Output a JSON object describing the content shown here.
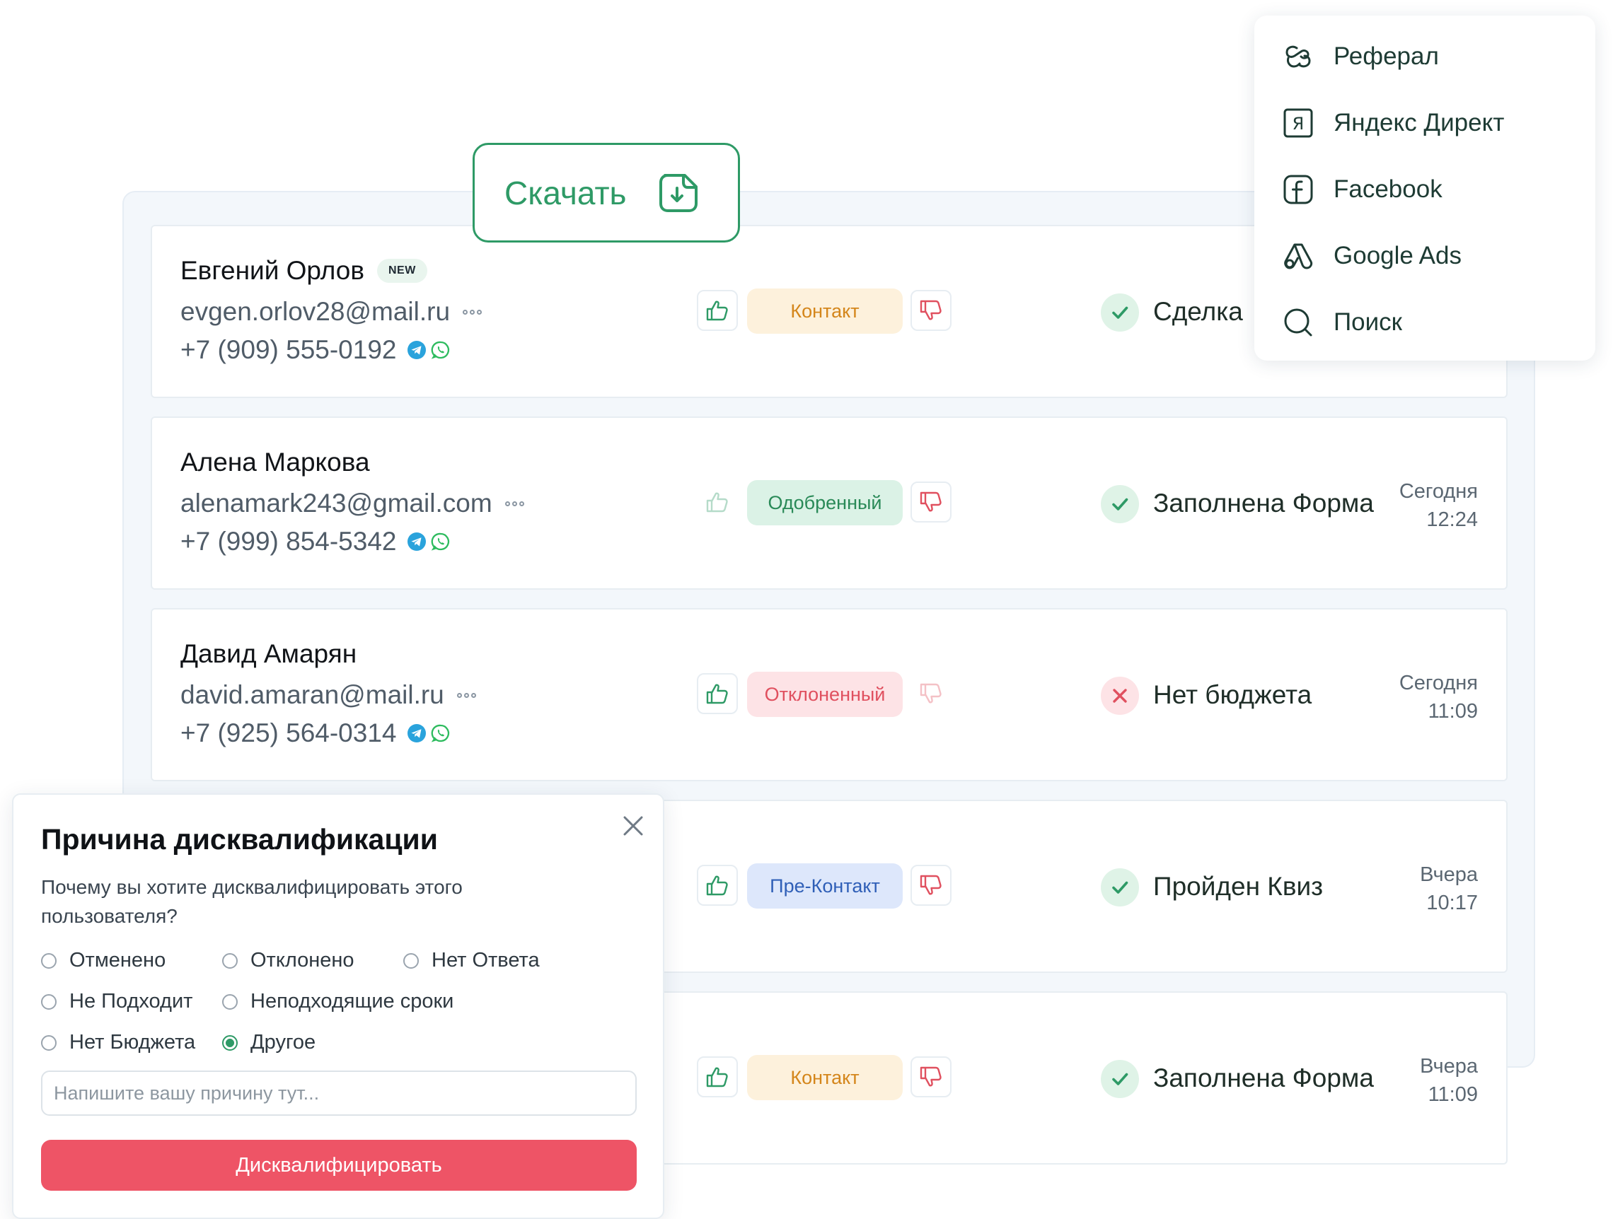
{
  "download": {
    "label": "Скачать"
  },
  "sources": [
    {
      "label": "Реферал",
      "icon": "referral-icon"
    },
    {
      "label": "Яндекс Директ",
      "icon": "yandex-icon"
    },
    {
      "label": "Facebook",
      "icon": "facebook-icon"
    },
    {
      "label": "Google Ads",
      "icon": "google-ads-icon"
    },
    {
      "label": "Поиск",
      "icon": "search-icon"
    }
  ],
  "leads": [
    {
      "name": "Евгений Орлов",
      "badge": "NEW",
      "email": "evgen.orlov28@mail.ru",
      "phone": "+7 (909) 555-0192",
      "status": "Контакт",
      "stage": "Сделка",
      "stage_ok": true,
      "date_day": "",
      "date_time": ""
    },
    {
      "name": "Алена Маркова",
      "badge": "",
      "email": "alenamark243@gmail.com",
      "phone": "+7 (999) 854-5342",
      "status": "Одобренный",
      "stage": "Заполнена Форма",
      "stage_ok": true,
      "date_day": "Сегодня",
      "date_time": "12:24"
    },
    {
      "name": "Давид Амарян",
      "badge": "",
      "email": "david.amaran@mail.ru",
      "phone": "+7 (925) 564-0314",
      "status": "Отклоненный",
      "stage": "Нет бюджета",
      "stage_ok": false,
      "date_day": "Сегодня",
      "date_time": "11:09"
    },
    {
      "name": "",
      "badge": "",
      "email": "",
      "phone": "",
      "status": "Пре-Контакт",
      "stage": "Пройден Квиз",
      "stage_ok": true,
      "date_day": "Вчера",
      "date_time": "10:17"
    },
    {
      "name": "",
      "badge": "",
      "email": "",
      "phone": "",
      "status": "Контакт",
      "stage": "Заполнена Форма",
      "stage_ok": true,
      "date_day": "Вчера",
      "date_time": "11:09"
    }
  ],
  "modal": {
    "title": "Причина дисквалификации",
    "question": "Почему вы хотите дисквалифицировать этого пользователя?",
    "options": [
      "Отменено",
      "Отклонено",
      "Нет Ответа",
      "Не Подходит",
      "Неподходящие сроки",
      "Нет Бюджета",
      "Другое"
    ],
    "selected": "Другое",
    "input_placeholder": "Напишите вашу причину тут...",
    "input_value": "",
    "submit_label": "Дисквалифицировать"
  },
  "colors": {
    "accent_green": "#2e9a66",
    "danger_red": "#ee5466",
    "contact_pill": "#fdf1dc",
    "approved_pill": "#dbf2e6",
    "rejected_pill": "#fde3e6",
    "precontact_pill": "#dde7fb"
  }
}
